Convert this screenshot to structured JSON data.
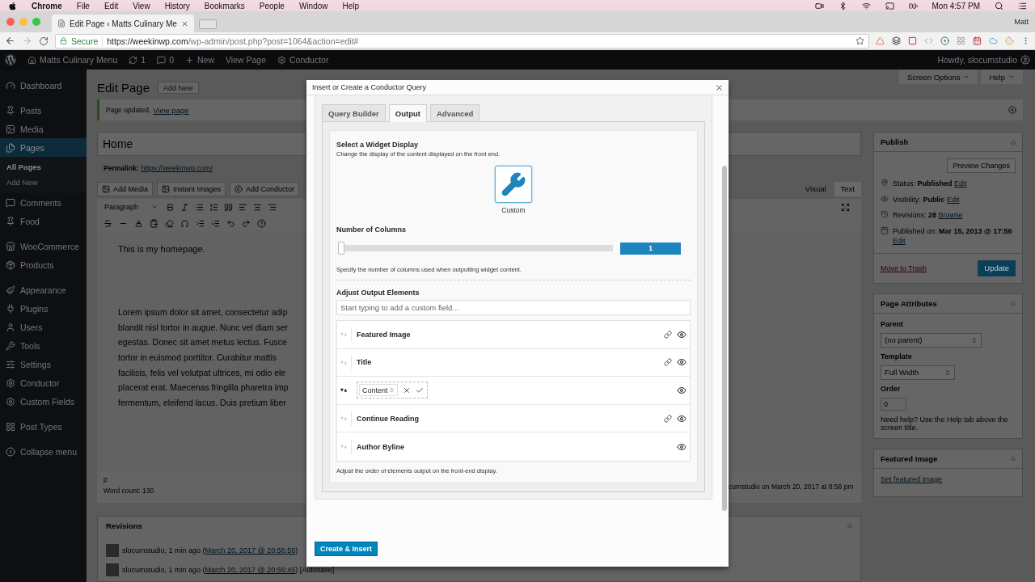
{
  "menu_bar": {
    "app": "Chrome",
    "menus": [
      "File",
      "Edit",
      "View",
      "History",
      "Bookmarks",
      "People",
      "Window",
      "Help"
    ],
    "clock": "Mon 4:57 PM"
  },
  "browser": {
    "tab_title": "Edit Page ‹ Matts Culinary Me",
    "profile": "Matt",
    "secure_label": "Secure",
    "url_host": "https://weekinwp.com",
    "url_path": "/wp-admin/post.php?post=1064&action=edit#"
  },
  "admin_bar": {
    "site": "Matts Culinary Menu",
    "updates": "1",
    "comments": "0",
    "new": "New",
    "view": "View Page",
    "conductor": "Conductor",
    "howdy": "Howdy, slocumstudio"
  },
  "sidebar": {
    "groups": [
      [
        {
          "label": "Dashboard",
          "selected": false
        }
      ],
      [
        {
          "label": "Posts",
          "selected": false
        },
        {
          "label": "Media",
          "selected": false
        },
        {
          "label": "Pages",
          "selected": true,
          "children": [
            {
              "label": "All Pages",
              "selected": true
            },
            {
              "label": "Add New",
              "selected": false
            }
          ]
        },
        {
          "label": "Comments",
          "selected": false
        },
        {
          "label": "Food",
          "selected": false
        }
      ],
      [
        {
          "label": "WooCommerce",
          "selected": false
        },
        {
          "label": "Products",
          "selected": false
        }
      ],
      [
        {
          "label": "Appearance",
          "selected": false
        },
        {
          "label": "Plugins",
          "selected": false
        },
        {
          "label": "Users",
          "selected": false
        },
        {
          "label": "Tools",
          "selected": false
        },
        {
          "label": "Settings",
          "selected": false
        },
        {
          "label": "Conductor",
          "selected": false
        },
        {
          "label": "Custom Fields",
          "selected": false
        }
      ],
      [
        {
          "label": "Post Types",
          "selected": false
        }
      ],
      [
        {
          "label": "Collapse menu",
          "selected": false
        }
      ]
    ]
  },
  "page_header": {
    "title": "Edit Page",
    "add_new": "Add New",
    "screen_options": "Screen Options",
    "help": "Help"
  },
  "notice": {
    "text": "Page updated.",
    "link": "View page"
  },
  "editor": {
    "title": "Home",
    "permalink_label": "Permalink:",
    "permalink": "https://weekinwp.com/",
    "media_buttons": [
      "Add Media",
      "Instant Images",
      "Add Conductor"
    ],
    "tabs": [
      {
        "label": "Visual",
        "selected": true
      },
      {
        "label": "Text",
        "selected": false
      }
    ],
    "format": "Paragraph",
    "intro": "This is my homepage.",
    "lines": [
      "Lorem ipsum dolor sit amet, consectetur adip",
      "blandit nisl tortor in augue. Nunc vel diam ser",
      "egestas. Donec sit amet metus lectus. Fusce",
      "tortor in euismod porttitor. Curabitur mattis",
      "facilisis, felis vel volutpat ultrices, mi odio ele",
      "placerat erat. Maecenas fringilla pharetra imp",
      "fermentum, eleifend lacus. Duis pretium liber"
    ],
    "path": "p",
    "word_count": "Word count: 130",
    "last_edit": "cumstudio on March 20, 2017 at 8:56 pm"
  },
  "revisions": {
    "title": "Revisions",
    "entries": [
      {
        "text": "slocumstudio, 1 min ago (",
        "link": "March 20, 2017 @ 20:56:56",
        "suffix": ")"
      },
      {
        "text": "slocumstudio, 1 min ago (",
        "link": "March 20, 2017 @ 20:56:45",
        "suffix": ") [Autosave]"
      }
    ]
  },
  "publish": {
    "title": "Publish",
    "preview": "Preview Changes",
    "rows": [
      {
        "label": "Status:",
        "value": "Published",
        "link": "Edit"
      },
      {
        "label": "Visibility:",
        "value": "Public",
        "link": "Edit"
      },
      {
        "label": "Revisions:",
        "value": "28",
        "link": "Browse"
      },
      {
        "label": "Published on:",
        "value": "Mar 15, 2013 @ 17:56",
        "link": "Edit"
      }
    ],
    "trash": "Move to Trash",
    "update": "Update"
  },
  "page_attributes": {
    "title": "Page Attributes",
    "parent_label": "Parent",
    "parent": "(no parent)",
    "template_label": "Template",
    "template": "Full Width",
    "order_label": "Order",
    "order": "0",
    "help": "Need help? Use the Help tab above the screen title."
  },
  "featured_image": {
    "title": "Featured Image",
    "link": "Set featured image"
  },
  "modal": {
    "title": "Insert or Create a Conductor Query",
    "tabs": [
      {
        "label": "Query Builder",
        "selected": false
      },
      {
        "label": "Output",
        "selected": true
      },
      {
        "label": "Advanced",
        "selected": false
      }
    ],
    "display_heading": "Select a Widget Display",
    "display_desc": "Change the display of the content displayed on the front end.",
    "displays": [
      {
        "label": "Custom",
        "selected": true
      }
    ],
    "columns_heading": "Number of Columns",
    "columns": {
      "level": 0,
      "value": "1"
    },
    "columns_desc": "Specify the number of columns used when outputting widget content.",
    "elements_heading": "Adjust Output Elements",
    "elements_placeholder": "Start typing to add a custom field...",
    "elements": [
      {
        "label": "Featured Image",
        "kind": "static",
        "link": true
      },
      {
        "label": "Title",
        "kind": "static",
        "link": true
      },
      {
        "label": "Content",
        "kind": "editing",
        "link": false
      },
      {
        "label": "Continue Reading",
        "kind": "static",
        "link": true
      },
      {
        "label": "Author Byline",
        "kind": "static",
        "link": false
      }
    ],
    "elements_desc": "Adjust the order of elements output on the front-end display.",
    "submit": "Create & Insert"
  }
}
